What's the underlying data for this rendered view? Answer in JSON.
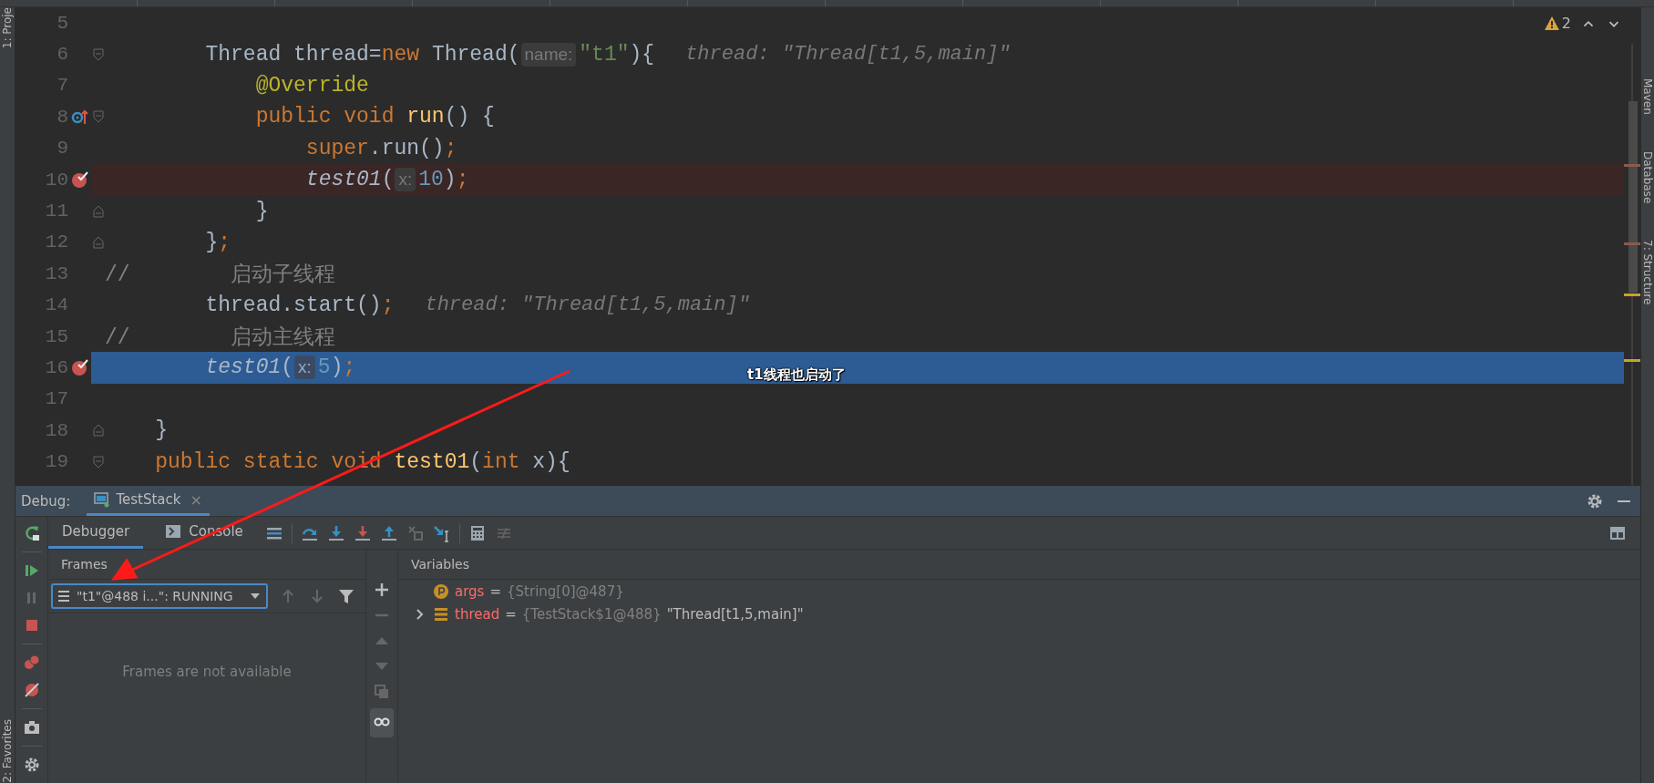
{
  "editor": {
    "problems": {
      "count": "2"
    },
    "lines": [
      {
        "number": "5"
      },
      {
        "number": "6",
        "fold_start": true,
        "tokens": [
          {
            "kind": "plain",
            "text": "        Thread thread="
          },
          {
            "kind": "keyword",
            "text": "new"
          },
          {
            "kind": "plain",
            "text": " Thread("
          },
          {
            "kind": "hint",
            "text": "name:"
          },
          {
            "kind": "string",
            "text": "\"t1\""
          },
          {
            "kind": "plain",
            "text": "){"
          },
          {
            "kind": "value",
            "text": "thread: \"Thread[t1,5,main]\""
          }
        ]
      },
      {
        "number": "7",
        "tokens": [
          {
            "kind": "annotation",
            "text": "            @Override"
          }
        ]
      },
      {
        "number": "8",
        "fold_start": true,
        "override": true,
        "tokens": [
          {
            "kind": "keyword",
            "text": "            public void "
          },
          {
            "kind": "method",
            "text": "run"
          },
          {
            "kind": "plain",
            "text": "() {"
          }
        ]
      },
      {
        "number": "9",
        "tokens": [
          {
            "kind": "keyword",
            "text": "                super"
          },
          {
            "kind": "plain",
            "text": ".run()"
          },
          {
            "kind": "keyword",
            "text": ";"
          }
        ]
      },
      {
        "number": "10",
        "breakpoint": true,
        "tokens": [
          {
            "kind": "call",
            "text": "                test01"
          },
          {
            "kind": "plain",
            "text": "("
          },
          {
            "kind": "hint",
            "text": "x:"
          },
          {
            "kind": "number",
            "text": "10"
          },
          {
            "kind": "plain",
            "text": ")"
          },
          {
            "kind": "keyword",
            "text": ";"
          }
        ]
      },
      {
        "number": "11",
        "fold_end": true,
        "tokens": [
          {
            "kind": "plain",
            "text": "            }"
          }
        ]
      },
      {
        "number": "12",
        "fold_end": true,
        "tokens": [
          {
            "kind": "plain",
            "text": "        }"
          },
          {
            "kind": "keyword",
            "text": ";"
          }
        ]
      },
      {
        "number": "13",
        "tokens": [
          {
            "kind": "comment",
            "text": "//        启动子线程"
          }
        ]
      },
      {
        "number": "14",
        "tokens": [
          {
            "kind": "plain",
            "text": "        thread.start()"
          },
          {
            "kind": "keyword",
            "text": ";"
          },
          {
            "kind": "value",
            "text": "thread: \"Thread[t1,5,main]\""
          }
        ]
      },
      {
        "number": "15",
        "tokens": [
          {
            "kind": "comment",
            "text": "//        启动主线程"
          }
        ]
      },
      {
        "number": "16",
        "breakpoint": true,
        "execution_point": true,
        "tokens": [
          {
            "kind": "call",
            "text": "        test01"
          },
          {
            "kind": "plain",
            "text": "("
          },
          {
            "kind": "hint",
            "text": "x:"
          },
          {
            "kind": "number",
            "text": "5"
          },
          {
            "kind": "plain",
            "text": ")"
          },
          {
            "kind": "keyword",
            "text": ";"
          }
        ]
      },
      {
        "number": "17"
      },
      {
        "number": "18",
        "fold_end": true,
        "tokens": [
          {
            "kind": "plain",
            "text": "    }"
          }
        ]
      },
      {
        "number": "19",
        "fold_start": true,
        "tokens": [
          {
            "kind": "keyword",
            "text": "    public static void "
          },
          {
            "kind": "method",
            "text": "test01"
          },
          {
            "kind": "plain",
            "text": "("
          },
          {
            "kind": "keyword",
            "text": "int"
          },
          {
            "kind": "plain",
            "text": " x){"
          }
        ]
      }
    ]
  },
  "debug": {
    "label": "Debug:",
    "session": {
      "title": "TestStack",
      "close": "×"
    },
    "tabs": [
      {
        "label": "Debugger",
        "selected": true
      },
      {
        "label": "Console",
        "selected": false
      }
    ],
    "frames": {
      "title": "Frames",
      "thread": "\"t1\"@488 i...\": RUNNING",
      "empty": "Frames are not available"
    },
    "variables": {
      "title": "Variables",
      "items": [
        {
          "kind": "param",
          "name": "args",
          "operator": "=",
          "type": "{String[0]@487}",
          "expandable": false
        },
        {
          "kind": "field",
          "name": "thread",
          "operator": "=",
          "type": "{TestStack$1@488}",
          "value": "\"Thread[t1,5,main]\"",
          "expandable": true
        }
      ]
    }
  },
  "side_strips": {
    "left": [
      "1: Proje",
      "2: Favorites"
    ],
    "right": [
      "Maven",
      "Database",
      "7: Structure"
    ]
  },
  "annotation": {
    "text": "t1线程也启动了"
  }
}
